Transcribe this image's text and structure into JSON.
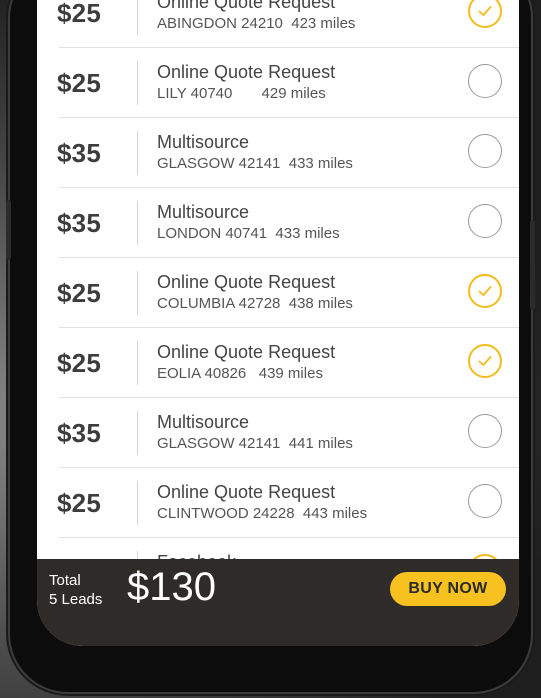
{
  "leads": [
    {
      "price": "$25",
      "title": "Online Quote Request",
      "location": "ABINGDON 24210  423 miles",
      "selected": true
    },
    {
      "price": "$25",
      "title": "Online Quote Request",
      "location": "LILY 40740       429 miles",
      "selected": false
    },
    {
      "price": "$35",
      "title": "Multisource",
      "location": "GLASGOW 42141  433 miles",
      "selected": false
    },
    {
      "price": "$35",
      "title": "Multisource",
      "location": "LONDON 40741  433 miles",
      "selected": false
    },
    {
      "price": "$25",
      "title": "Online Quote Request",
      "location": "COLUMBIA 42728  438 miles",
      "selected": true
    },
    {
      "price": "$25",
      "title": "Online Quote Request",
      "location": "EOLIA 40826   439 miles",
      "selected": true
    },
    {
      "price": "$35",
      "title": "Multisource",
      "location": "GLASGOW 42141  441 miles",
      "selected": false
    },
    {
      "price": "$25",
      "title": "Online Quote Request",
      "location": "CLINTWOOD 24228  443 miles",
      "selected": false
    },
    {
      "price": "",
      "title": "Facebook",
      "location": "",
      "selected": true
    }
  ],
  "footer": {
    "total_label": "Total",
    "leads_count": "5 Leads",
    "total_amount": "$130",
    "buy_label": "BUY NOW"
  },
  "colors": {
    "accent": "#f7c21f",
    "check_on": "#f2bc1b",
    "footer_bg": "#2f2b28"
  },
  "icons": {
    "selected": "check-circle-icon",
    "unselected": "empty-circle-icon"
  }
}
